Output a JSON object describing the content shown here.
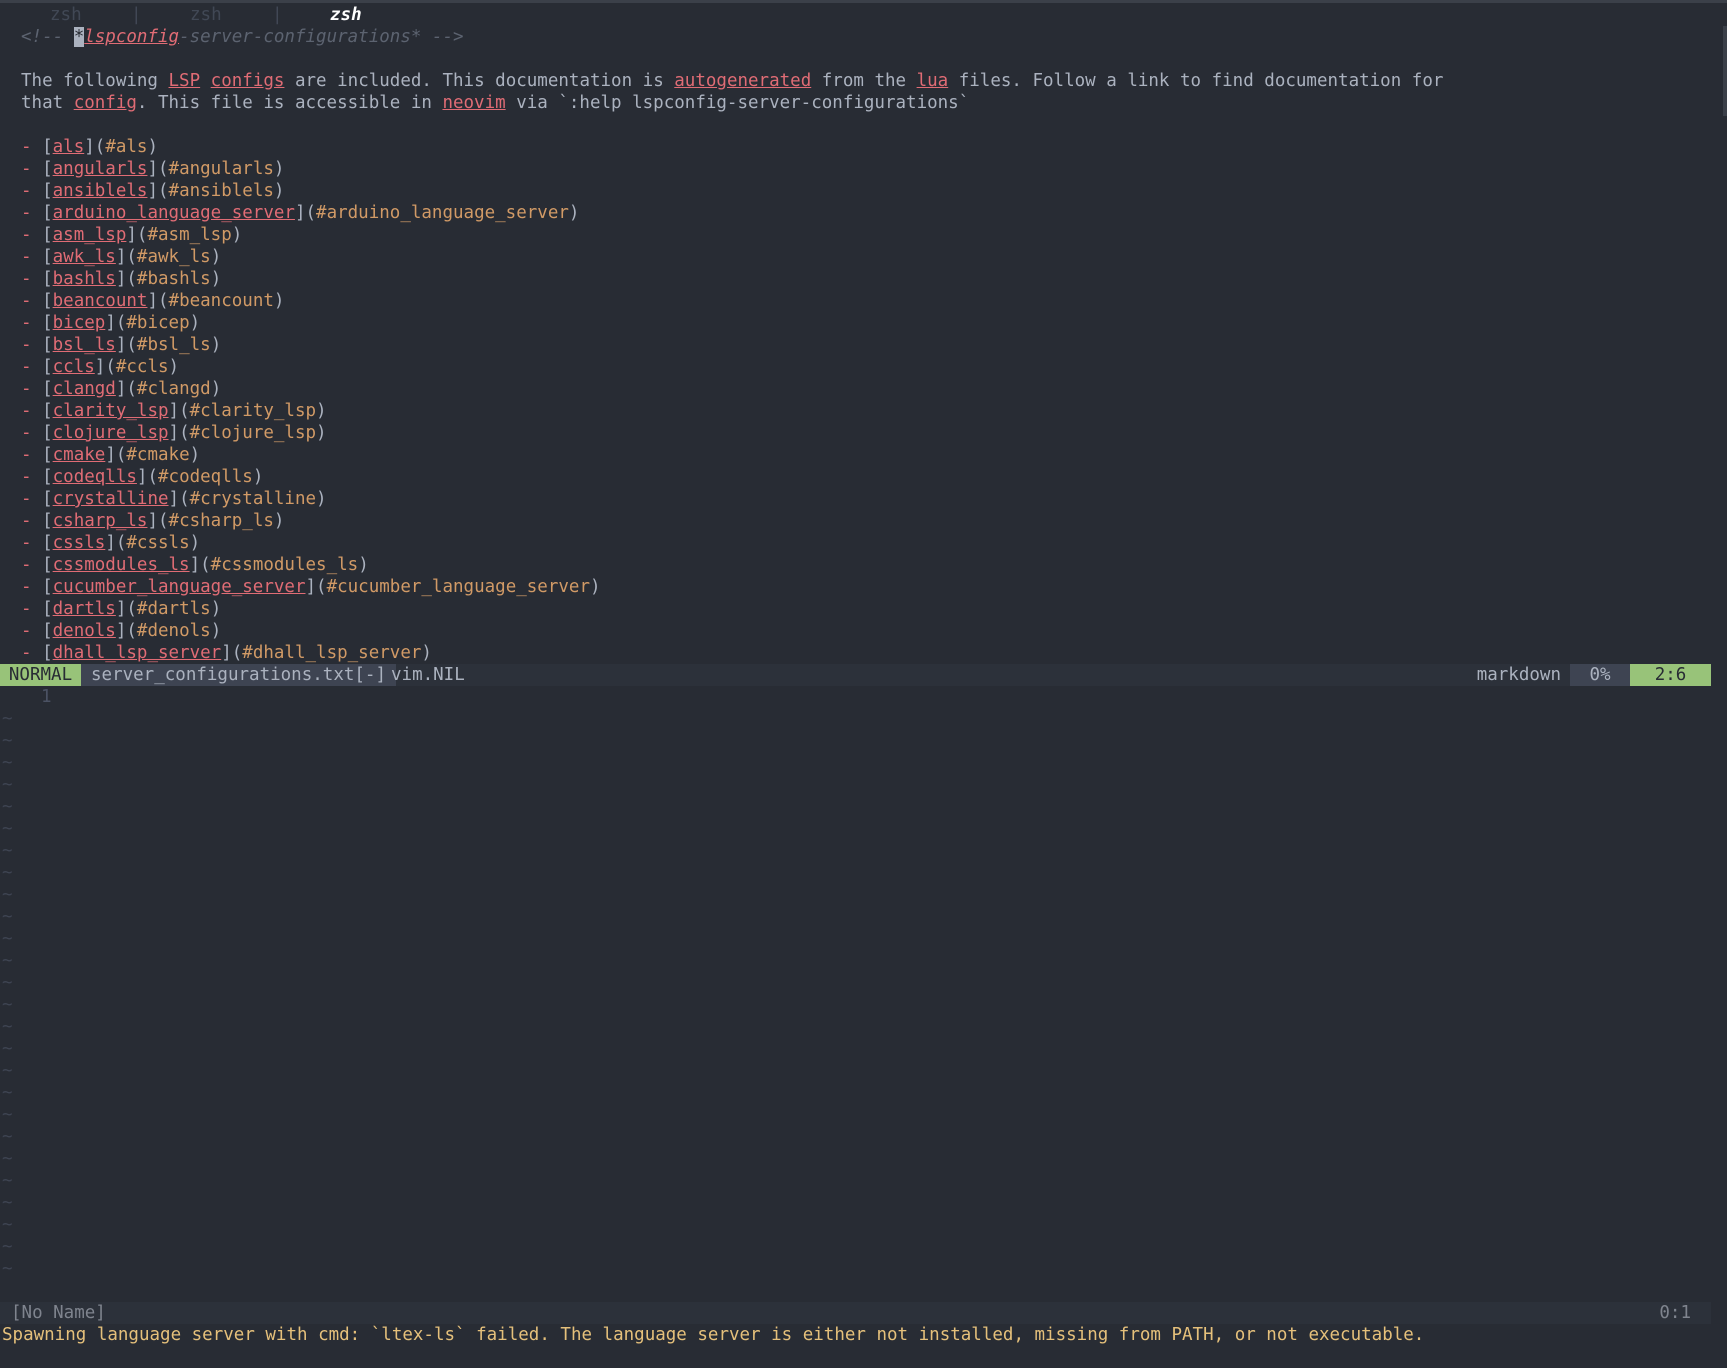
{
  "tabs": [
    {
      "label": "zsh",
      "active": false
    },
    {
      "label": "zsh",
      "active": false
    },
    {
      "label": "zsh",
      "active": true
    }
  ],
  "tab_separator": "|",
  "header": {
    "open": "<!-- ",
    "cursor_char": "*",
    "tag": "lspconfig",
    "rest": "-server-configurations* -->"
  },
  "intro": {
    "l1_a": "The following ",
    "lsp": "LSP",
    "sp1": " ",
    "configs": "configs",
    "l1_b": " are included. This documentation is ",
    "autogenerated": "autogenerated",
    "l1_c": " from the ",
    "lua": "lua",
    "l1_d": " files. Follow a link to find documentation for",
    "l2_a": "that ",
    "config": "config",
    "l2_b": ". This file is accessible in ",
    "neovim": "neovim",
    "l2_c": " via `:help lspconfig-server-configurations`"
  },
  "list": {
    "dash": "- ",
    "open": "[",
    "mid": "](",
    "close": ")",
    "items": [
      {
        "name": "als",
        "anchor": "#als"
      },
      {
        "name": "angularls",
        "anchor": "#angularls"
      },
      {
        "name": "ansiblels",
        "anchor": "#ansiblels"
      },
      {
        "name": "arduino_language_server",
        "anchor": "#arduino_language_server"
      },
      {
        "name": "asm_lsp",
        "anchor": "#asm_lsp"
      },
      {
        "name": "awk_ls",
        "anchor": "#awk_ls"
      },
      {
        "name": "bashls",
        "anchor": "#bashls"
      },
      {
        "name": "beancount",
        "anchor": "#beancount"
      },
      {
        "name": "bicep",
        "anchor": "#bicep"
      },
      {
        "name": "bsl_ls",
        "anchor": "#bsl_ls"
      },
      {
        "name": "ccls",
        "anchor": "#ccls"
      },
      {
        "name": "clangd",
        "anchor": "#clangd"
      },
      {
        "name": "clarity_lsp",
        "anchor": "#clarity_lsp"
      },
      {
        "name": "clojure_lsp",
        "anchor": "#clojure_lsp"
      },
      {
        "name": "cmake",
        "anchor": "#cmake"
      },
      {
        "name": "codeqlls",
        "anchor": "#codeqlls"
      },
      {
        "name": "crystalline",
        "anchor": "#crystalline"
      },
      {
        "name": "csharp_ls",
        "anchor": "#csharp_ls"
      },
      {
        "name": "cssls",
        "anchor": "#cssls"
      },
      {
        "name": "cssmodules_ls",
        "anchor": "#cssmodules_ls"
      },
      {
        "name": "cucumber_language_server",
        "anchor": "#cucumber_language_server"
      },
      {
        "name": "dartls",
        "anchor": "#dartls"
      },
      {
        "name": "denols",
        "anchor": "#denols"
      },
      {
        "name": "dhall_lsp_server",
        "anchor": "#dhall_lsp_server"
      }
    ]
  },
  "statusline": {
    "mode": "NORMAL",
    "filename": "server_configurations.txt[-]",
    "branch": "vim.NIL",
    "filetype": "markdown",
    "percent": "0%",
    "position": "2:6"
  },
  "lower": {
    "line_number": "1",
    "tilde": "~",
    "tilde_count": 26
  },
  "bottom_status": {
    "name": "[No Name]",
    "position": "0:1"
  },
  "cmdline": "Spawning language server with cmd: `ltex-ls` failed. The language server is either not installed, missing from PATH, or not executable.",
  "colors": {
    "background": "#282c34",
    "mode_bg": "#98c379",
    "link": "#e06c75",
    "anchor": "#d19a66",
    "message": "#e5c07b"
  }
}
